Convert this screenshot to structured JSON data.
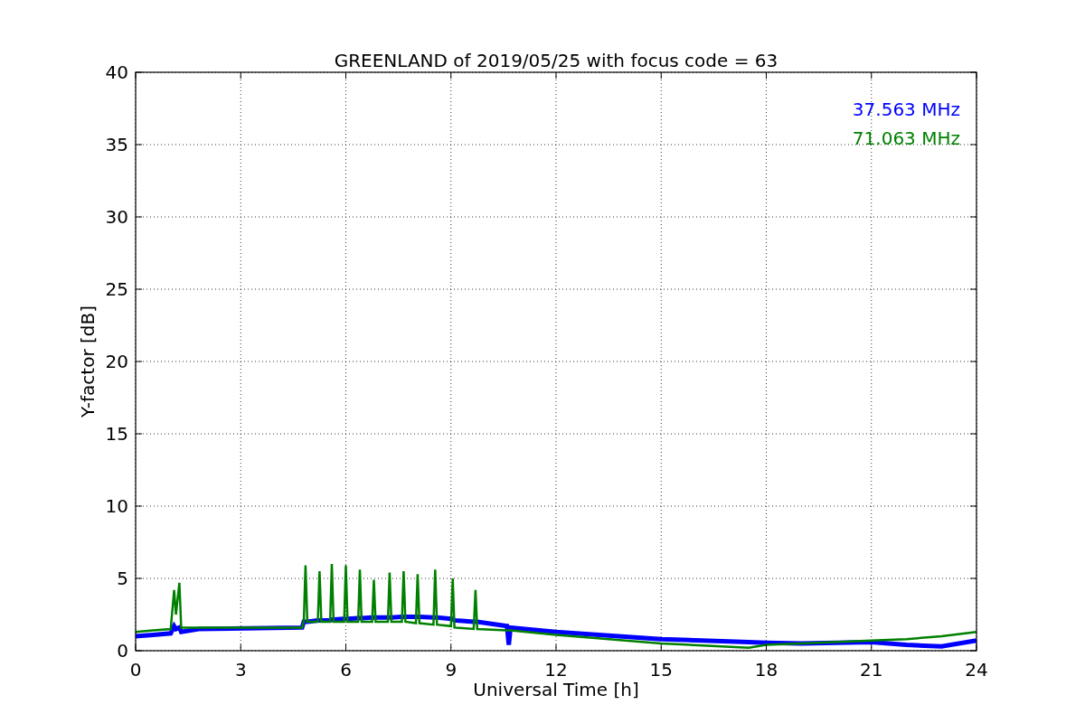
{
  "chart_data": {
    "type": "line",
    "title": "GREENLAND of 2019/05/25 with focus code = 63",
    "xlabel": "Universal Time [h]",
    "ylabel": "Y-factor [dB]",
    "x": [
      0,
      0.5,
      1.0,
      1.1,
      1.15,
      1.25,
      1.3,
      1.8,
      4.75,
      4.8,
      4.85,
      4.9,
      5.2,
      5.25,
      5.3,
      5.55,
      5.6,
      5.65,
      5.95,
      6.0,
      6.05,
      6.35,
      6.4,
      6.45,
      6.75,
      6.8,
      6.85,
      7.2,
      7.25,
      7.3,
      7.6,
      7.65,
      7.7,
      8.0,
      8.05,
      8.1,
      8.5,
      8.55,
      8.6,
      9.0,
      9.05,
      9.1,
      9.65,
      9.7,
      9.75,
      10.6,
      10.65,
      10.7,
      12,
      15,
      17.5,
      18,
      19,
      21,
      22,
      23,
      24
    ],
    "series": [
      {
        "name": "37.563 MHz",
        "color": "#0000ff",
        "values": [
          1.0,
          1.1,
          1.2,
          1.7,
          1.5,
          1.6,
          1.3,
          1.5,
          1.6,
          2.0,
          2.0,
          2.0,
          2.1,
          2.1,
          2.1,
          2.1,
          2.15,
          2.15,
          2.2,
          2.2,
          2.2,
          2.25,
          2.25,
          2.25,
          2.3,
          2.3,
          2.3,
          2.3,
          2.3,
          2.3,
          2.35,
          2.35,
          2.35,
          2.35,
          2.35,
          2.35,
          2.3,
          2.3,
          2.3,
          2.2,
          2.2,
          2.1,
          2.0,
          2.0,
          2.0,
          1.7,
          0.4,
          1.6,
          1.3,
          0.8,
          0.6,
          0.55,
          0.5,
          0.6,
          0.4,
          0.3,
          0.7
        ]
      },
      {
        "name": "71.063 MHz",
        "color": "#008000",
        "values": [
          1.3,
          1.4,
          1.5,
          4.2,
          2.5,
          4.7,
          1.6,
          1.6,
          1.6,
          2.0,
          5.9,
          2.0,
          2.0,
          5.5,
          2.0,
          2.0,
          6.0,
          2.0,
          2.0,
          5.9,
          2.0,
          2.0,
          5.6,
          2.0,
          2.0,
          4.9,
          2.0,
          2.0,
          5.4,
          2.0,
          2.0,
          5.5,
          2.0,
          1.9,
          5.3,
          1.9,
          1.8,
          5.6,
          1.8,
          1.7,
          5.0,
          1.6,
          1.5,
          4.2,
          1.5,
          1.4,
          1.4,
          1.4,
          1.1,
          0.5,
          0.2,
          0.4,
          0.5,
          0.7,
          0.8,
          1.0,
          1.3
        ]
      }
    ],
    "xlim": [
      0,
      24
    ],
    "ylim": [
      0,
      40
    ],
    "xticks": [
      0,
      3,
      6,
      9,
      12,
      15,
      18,
      21,
      24
    ],
    "yticks": [
      0,
      5,
      10,
      15,
      20,
      25,
      30,
      35,
      40
    ],
    "grid": true
  }
}
